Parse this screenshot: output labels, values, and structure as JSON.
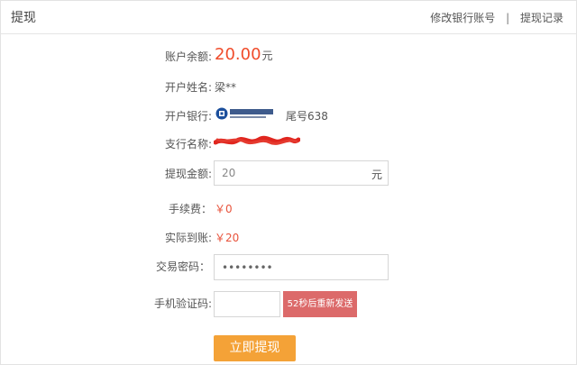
{
  "header": {
    "title": "提现",
    "links": [
      "修改银行账号",
      "提现记录"
    ],
    "separator": "|"
  },
  "form": {
    "balance": {
      "label": "账户余额:",
      "amount": "20.00",
      "unit": "元"
    },
    "account_name": {
      "label": "开户姓名:",
      "value": "梁**"
    },
    "bank": {
      "label": "开户银行:",
      "logo_icon": "china-construction-bank-logo",
      "tail": "尾号638"
    },
    "branch": {
      "label": "支行名称:"
    },
    "withdraw_amount": {
      "label": "提现金额:",
      "value": "20",
      "unit": "元"
    },
    "fee": {
      "label": "手续费：",
      "value": "￥0"
    },
    "actual": {
      "label": "实际到账:",
      "value": "￥20"
    },
    "password": {
      "label": "交易密码：",
      "value": "12345678"
    },
    "sms_code": {
      "label": "手机验证码:",
      "value": "",
      "resend_label": "52秒后重新发送"
    },
    "submit_label": "立即提现"
  },
  "colors": {
    "accent_red": "#f04c2b",
    "resend_bg": "#dc6a6a",
    "submit_bg": "#f4a237"
  }
}
